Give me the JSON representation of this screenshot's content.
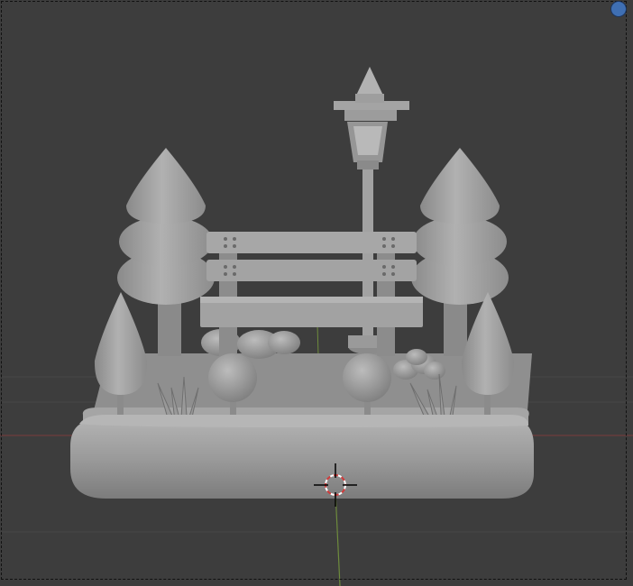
{
  "viewport": {
    "mode": "3d-viewport",
    "shading": "solid",
    "background_color": "#3d3d3d",
    "object_color": "#9d9d9d"
  },
  "scene": {
    "objects": [
      "base-platform",
      "park-bench",
      "street-lamp",
      "cone-tree-left",
      "cone-tree-right",
      "small-tree-left",
      "small-tree-right",
      "round-bush-left",
      "round-bush-right",
      "grass-left",
      "grass-right",
      "rock-cluster",
      "flower-bush"
    ]
  },
  "axes": {
    "x_axis_color": "#8a3b3b",
    "y_axis_color": "#6e8b3d"
  },
  "gizmo": {
    "icon": "navigation-sphere-icon",
    "color": "#3f6fb3"
  },
  "cursor": {
    "icon": "3d-cursor-icon"
  }
}
